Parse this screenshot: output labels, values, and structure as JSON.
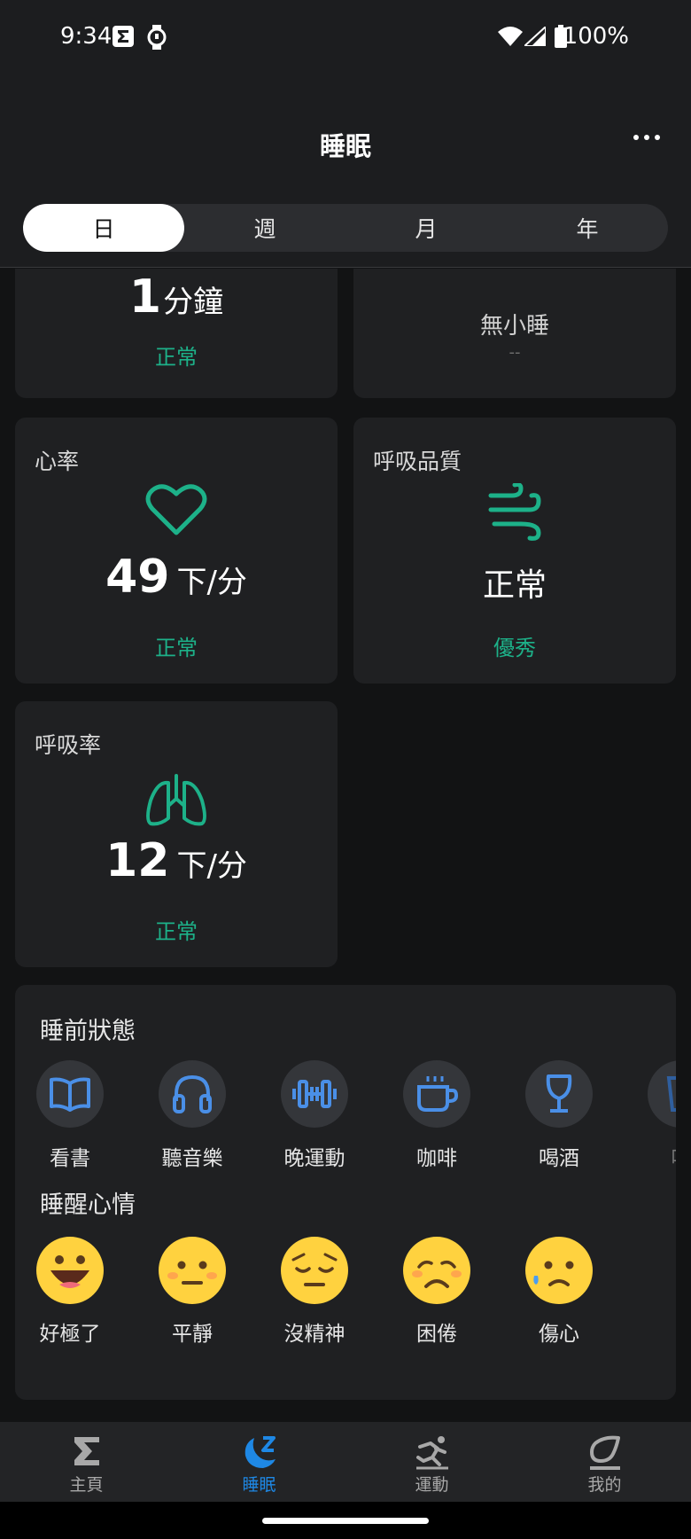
{
  "status_bar": {
    "time": "9:34",
    "battery": "100%"
  },
  "header": {
    "title": "睡眠"
  },
  "tabs": [
    {
      "label": "日"
    },
    {
      "label": "週"
    },
    {
      "label": "月"
    },
    {
      "label": "年"
    }
  ],
  "cards": {
    "awake": {
      "value": "1",
      "unit": "分鐘",
      "status": "正常"
    },
    "nap": {
      "title": "無小睡",
      "value": "--"
    },
    "heart_rate": {
      "title": "心率",
      "value": "49",
      "unit": "下/分",
      "status": "正常"
    },
    "breathing_quality": {
      "title": "呼吸品質",
      "value": "正常",
      "status": "優秀"
    },
    "breathing_rate": {
      "title": "呼吸率",
      "value": "12",
      "unit": "下/分",
      "status": "正常"
    }
  },
  "pre_sleep": {
    "title": "睡前狀態",
    "items": [
      {
        "label": "看書",
        "icon": "book-icon"
      },
      {
        "label": "聽音樂",
        "icon": "headphones-icon"
      },
      {
        "label": "晚運動",
        "icon": "dumbbell-icon"
      },
      {
        "label": "咖啡",
        "icon": "coffee-icon"
      },
      {
        "label": "喝酒",
        "icon": "wine-glass-icon"
      },
      {
        "label": "喝",
        "icon": "cup-icon"
      }
    ]
  },
  "wake_mood": {
    "title": "睡醒心情",
    "items": [
      {
        "label": "好極了",
        "icon": "grinning-face-icon"
      },
      {
        "label": "平靜",
        "icon": "neutral-face-icon"
      },
      {
        "label": "沒精神",
        "icon": "tired-face-icon"
      },
      {
        "label": "困倦",
        "icon": "weary-face-icon"
      },
      {
        "label": "傷心",
        "icon": "sad-face-icon"
      }
    ]
  },
  "nav": [
    {
      "label": "主頁",
      "icon": "sigma-icon"
    },
    {
      "label": "睡眠",
      "icon": "moon-sleep-icon"
    },
    {
      "label": "運動",
      "icon": "running-icon"
    },
    {
      "label": "我的",
      "icon": "profile-icon"
    }
  ],
  "colors": {
    "accent_green": "#1db189",
    "accent_blue": "#1e88e5",
    "icon_blue": "#4a8fe7",
    "emoji_yellow": "#ffd23f"
  }
}
